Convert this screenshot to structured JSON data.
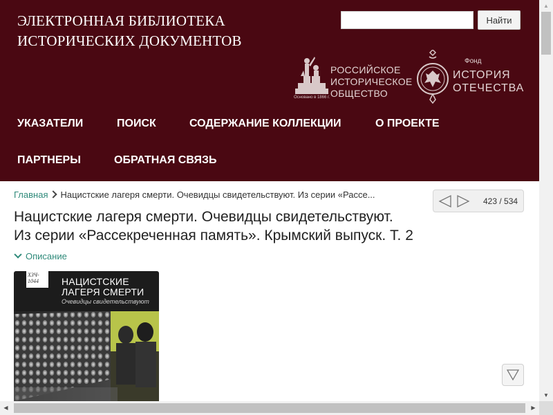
{
  "site": {
    "title_line1": "ЭЛЕКТРОННАЯ БИБЛИОТЕКА",
    "title_line2": "ИСТОРИЧЕСКИХ ДОКУМЕНТОВ"
  },
  "search": {
    "value": "",
    "placeholder": "",
    "button_label": "Найти"
  },
  "logos": {
    "rio": {
      "line1": "РОССИЙСКОЕ",
      "line2": "ИСТОРИЧЕСКОЕ",
      "line3": "ОБЩЕСТВО",
      "founded": "Основано в 1866 г."
    },
    "fond": {
      "small": "Фонд",
      "line1": "ИСТОРИЯ",
      "line2": "ОТЕЧЕСТВА"
    }
  },
  "nav": {
    "items": [
      {
        "label": "УКАЗАТЕЛИ"
      },
      {
        "label": "ПОИСК"
      },
      {
        "label": "СОДЕРЖАНИЕ КОЛЛЕКЦИИ"
      },
      {
        "label": "О ПРОЕКТЕ"
      },
      {
        "label": "ПАРТНЕРЫ"
      },
      {
        "label": "ОБРАТНАЯ СВЯЗЬ"
      }
    ]
  },
  "breadcrumb": {
    "home": "Главная",
    "current": "Нацистские лагеря смерти. Очевидцы свидетельствуют. Из серии «Рассе..."
  },
  "pager": {
    "count": "423 / 534"
  },
  "document": {
    "title_line1": "Нацистские лагеря смерти. Очевидцы свидетельствуют.",
    "title_line2": "Из серии «Рассекреченная память». Крымский выпуск. Т. 2",
    "description_toggle": "Описание",
    "cover": {
      "tag_line1": "ХЗЧ-",
      "tag_line2": "1044",
      "title_line1": "НАЦИСТСКИЕ",
      "title_line2": "ЛАГЕРЯ СМЕРТИ",
      "subtitle": "Очевидцы свидетельствуют"
    }
  },
  "colors": {
    "header_bg": "#4a0812",
    "link": "#2f8a7a"
  }
}
